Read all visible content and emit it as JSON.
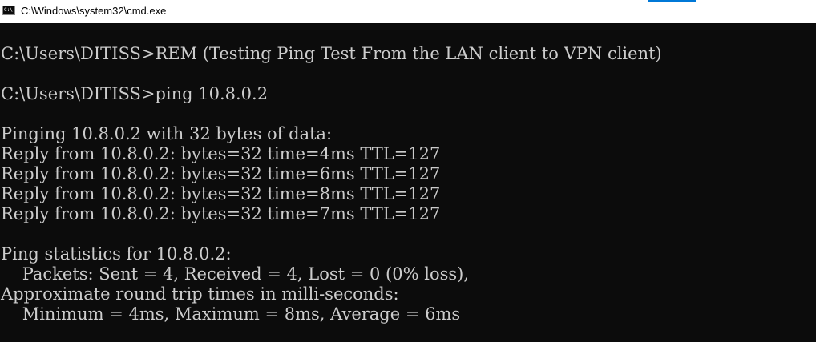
{
  "window": {
    "title": "C:\\Windows\\system32\\cmd.exe",
    "icon": "cmd-icon",
    "icon_glyph": "C:\\.",
    "colors": {
      "console_bg": "#0c0c0c",
      "console_fg": "#cccccc",
      "titlebar_bg": "#ffffff",
      "accent": "#0078d7"
    }
  },
  "console": {
    "lines": [
      "C:\\Users\\DITISS>REM (Testing Ping Test From the LAN client to VPN client)",
      "",
      "C:\\Users\\DITISS>ping 10.8.0.2",
      "",
      "Pinging 10.8.0.2 with 32 bytes of data:",
      "Reply from 10.8.0.2: bytes=32 time=4ms TTL=127",
      "Reply from 10.8.0.2: bytes=32 time=6ms TTL=127",
      "Reply from 10.8.0.2: bytes=32 time=8ms TTL=127",
      "Reply from 10.8.0.2: bytes=32 time=7ms TTL=127",
      "",
      "Ping statistics for 10.8.0.2:",
      "    Packets: Sent = 4, Received = 4, Lost = 0 (0% loss),",
      "Approximate round trip times in milli-seconds:",
      "    Minimum = 4ms, Maximum = 8ms, Average = 6ms"
    ]
  }
}
